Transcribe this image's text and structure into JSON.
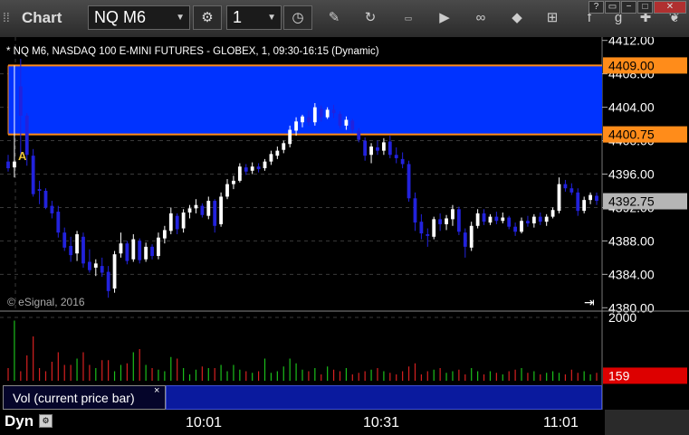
{
  "toolbar": {
    "app_title": "Chart",
    "symbol": "NQ M6",
    "interval": "1"
  },
  "window_buttons": [
    "?",
    "▭",
    "−",
    "□",
    "✕"
  ],
  "chart": {
    "header": "* NQ M6, NASDAQ 100 E-MINI FUTURES - GLOBEX, 1, 09:30-16:15 (Dynamic)",
    "watermark": "© eSignal, 2016",
    "marker": "A",
    "price_axis": {
      "ticks": [
        {
          "label": "4412.00",
          "value": 4412
        },
        {
          "label": "4408.00",
          "value": 4408
        },
        {
          "label": "4404.00",
          "value": 4404
        },
        {
          "label": "4400.00",
          "value": 4400
        },
        {
          "label": "4396.00",
          "value": 4396
        },
        {
          "label": "4392.00",
          "value": 4392
        },
        {
          "label": "4388.00",
          "value": 4388
        },
        {
          "label": "4384.00",
          "value": 4384
        },
        {
          "label": "4380.00",
          "value": 4380
        }
      ],
      "min": 4379.6,
      "max": 4412.4
    },
    "zone": {
      "top": 4409.0,
      "bottom": 4400.75,
      "top_label": "4409.00",
      "bottom_label": "4400.75"
    },
    "last_price": {
      "value": 4392.75,
      "label": "4392.75"
    },
    "candles": [
      {
        "o": 4397.5,
        "h": 4398.3,
        "l": 4396.3,
        "c": 4396.7
      },
      {
        "o": 4396.8,
        "h": 4409.0,
        "l": 4395.6,
        "c": 4397.5
      },
      {
        "o": 4406.5,
        "h": 4409.8,
        "l": 4398.0,
        "c": 4403.0
      },
      {
        "o": 4403.0,
        "h": 4403.3,
        "l": 4397.0,
        "c": 4398.3
      },
      {
        "o": 4398.2,
        "h": 4399.0,
        "l": 4393.3,
        "c": 4393.6
      },
      {
        "o": 4394.2,
        "h": 4395.2,
        "l": 4392.4,
        "c": 4394.0
      },
      {
        "o": 4394.0,
        "h": 4394.3,
        "l": 4391.8,
        "c": 4392.0
      },
      {
        "o": 4392.2,
        "h": 4392.8,
        "l": 4390.7,
        "c": 4391.3
      },
      {
        "o": 4391.5,
        "h": 4392.2,
        "l": 4388.4,
        "c": 4389.0
      },
      {
        "o": 4389.0,
        "h": 4389.6,
        "l": 4386.8,
        "c": 4387.2
      },
      {
        "o": 4387.4,
        "h": 4388.5,
        "l": 4385.5,
        "c": 4386.3
      },
      {
        "o": 4386.5,
        "h": 4389.2,
        "l": 4385.6,
        "c": 4388.8
      },
      {
        "o": 4388.5,
        "h": 4389.0,
        "l": 4384.8,
        "c": 4385.3
      },
      {
        "o": 4385.5,
        "h": 4387.0,
        "l": 4384.2,
        "c": 4384.5
      },
      {
        "o": 4384.8,
        "h": 4385.8,
        "l": 4383.8,
        "c": 4385.3
      },
      {
        "o": 4385.0,
        "h": 4386.0,
        "l": 4383.7,
        "c": 4384.2
      },
      {
        "o": 4384.3,
        "h": 4385.0,
        "l": 4381.2,
        "c": 4382.0
      },
      {
        "o": 4382.3,
        "h": 4386.8,
        "l": 4381.8,
        "c": 4386.4
      },
      {
        "o": 4386.5,
        "h": 4389.0,
        "l": 4386.0,
        "c": 4387.7
      },
      {
        "o": 4387.7,
        "h": 4388.0,
        "l": 4385.2,
        "c": 4385.6
      },
      {
        "o": 4385.8,
        "h": 4388.8,
        "l": 4385.5,
        "c": 4388.2
      },
      {
        "o": 4388.0,
        "h": 4388.3,
        "l": 4385.3,
        "c": 4385.7
      },
      {
        "o": 4385.8,
        "h": 4387.8,
        "l": 4385.5,
        "c": 4387.3
      },
      {
        "o": 4387.3,
        "h": 4387.6,
        "l": 4385.8,
        "c": 4386.2
      },
      {
        "o": 4386.2,
        "h": 4389.0,
        "l": 4385.8,
        "c": 4388.4
      },
      {
        "o": 4388.3,
        "h": 4389.8,
        "l": 4387.7,
        "c": 4389.3
      },
      {
        "o": 4389.2,
        "h": 4392.0,
        "l": 4388.8,
        "c": 4391.3
      },
      {
        "o": 4391.0,
        "h": 4391.3,
        "l": 4388.8,
        "c": 4389.4
      },
      {
        "o": 4389.5,
        "h": 4391.8,
        "l": 4389.0,
        "c": 4391.4
      },
      {
        "o": 4391.4,
        "h": 4392.3,
        "l": 4390.7,
        "c": 4391.9
      },
      {
        "o": 4391.9,
        "h": 4393.0,
        "l": 4391.3,
        "c": 4392.3
      },
      {
        "o": 4392.2,
        "h": 4392.5,
        "l": 4390.8,
        "c": 4391.1
      },
      {
        "o": 4391.0,
        "h": 4393.3,
        "l": 4390.6,
        "c": 4392.8
      },
      {
        "o": 4392.8,
        "h": 4393.0,
        "l": 4389.0,
        "c": 4389.8
      },
      {
        "o": 4390.0,
        "h": 4393.8,
        "l": 4389.7,
        "c": 4393.3
      },
      {
        "o": 4393.3,
        "h": 4395.4,
        "l": 4393.0,
        "c": 4394.8
      },
      {
        "o": 4394.8,
        "h": 4395.8,
        "l": 4394.2,
        "c": 4395.2
      },
      {
        "o": 4395.2,
        "h": 4397.3,
        "l": 4395.0,
        "c": 4396.9
      },
      {
        "o": 4396.8,
        "h": 4397.2,
        "l": 4395.9,
        "c": 4396.3
      },
      {
        "o": 4396.4,
        "h": 4397.4,
        "l": 4396.0,
        "c": 4396.9
      },
      {
        "o": 4396.9,
        "h": 4397.3,
        "l": 4396.2,
        "c": 4396.6
      },
      {
        "o": 4396.7,
        "h": 4397.8,
        "l": 4396.4,
        "c": 4397.5
      },
      {
        "o": 4397.5,
        "h": 4398.8,
        "l": 4397.1,
        "c": 4398.4
      },
      {
        "o": 4398.2,
        "h": 4399.3,
        "l": 4397.8,
        "c": 4398.8
      },
      {
        "o": 4398.9,
        "h": 4400.0,
        "l": 4398.5,
        "c": 4399.7
      },
      {
        "o": 4399.6,
        "h": 4401.8,
        "l": 4399.2,
        "c": 4401.3
      },
      {
        "o": 4401.2,
        "h": 4402.8,
        "l": 4400.6,
        "c": 4402.3
      },
      {
        "o": 4402.2,
        "h": 4403.1,
        "l": 4401.6,
        "c": 4402.9
      },
      {
        "o": 4402.8,
        "h": 4403.6,
        "l": 4401.8,
        "c": 4402.2
      },
      {
        "o": 4402.2,
        "h": 4404.5,
        "l": 4401.8,
        "c": 4404.0
      },
      {
        "o": 4403.8,
        "h": 4404.2,
        "l": 4402.3,
        "c": 4402.8
      },
      {
        "o": 4402.8,
        "h": 4404.0,
        "l": 4402.6,
        "c": 4403.7
      },
      {
        "o": 4403.7,
        "h": 4404.3,
        "l": 4402.7,
        "c": 4403.3
      },
      {
        "o": 4403.2,
        "h": 4403.5,
        "l": 4401.5,
        "c": 4401.8
      },
      {
        "o": 4401.8,
        "h": 4402.9,
        "l": 4401.3,
        "c": 4402.5
      },
      {
        "o": 4402.4,
        "h": 4402.6,
        "l": 4400.9,
        "c": 4401.3
      },
      {
        "o": 4401.2,
        "h": 4401.5,
        "l": 4399.8,
        "c": 4400.1
      },
      {
        "o": 4400.0,
        "h": 4400.4,
        "l": 4397.6,
        "c": 4398.2
      },
      {
        "o": 4398.3,
        "h": 4399.7,
        "l": 4397.3,
        "c": 4399.3
      },
      {
        "o": 4399.2,
        "h": 4400.0,
        "l": 4398.3,
        "c": 4398.8
      },
      {
        "o": 4398.8,
        "h": 4400.3,
        "l": 4398.3,
        "c": 4399.8
      },
      {
        "o": 4399.9,
        "h": 4400.6,
        "l": 4397.9,
        "c": 4398.3
      },
      {
        "o": 4398.3,
        "h": 4399.2,
        "l": 4397.3,
        "c": 4397.9
      },
      {
        "o": 4397.8,
        "h": 4398.6,
        "l": 4396.7,
        "c": 4397.2
      },
      {
        "o": 4397.2,
        "h": 4397.6,
        "l": 4392.7,
        "c": 4393.1
      },
      {
        "o": 4393.1,
        "h": 4393.8,
        "l": 4389.2,
        "c": 4390.2
      },
      {
        "o": 4390.3,
        "h": 4391.2,
        "l": 4388.2,
        "c": 4388.9
      },
      {
        "o": 4388.8,
        "h": 4389.5,
        "l": 4387.3,
        "c": 4388.6
      },
      {
        "o": 4388.5,
        "h": 4390.9,
        "l": 4388.2,
        "c": 4390.6
      },
      {
        "o": 4390.6,
        "h": 4391.3,
        "l": 4389.2,
        "c": 4390.0
      },
      {
        "o": 4390.0,
        "h": 4391.1,
        "l": 4389.3,
        "c": 4390.7
      },
      {
        "o": 4390.6,
        "h": 4392.3,
        "l": 4389.8,
        "c": 4391.8
      },
      {
        "o": 4391.8,
        "h": 4392.1,
        "l": 4388.7,
        "c": 4389.1
      },
      {
        "o": 4389.0,
        "h": 4389.5,
        "l": 4386.0,
        "c": 4387.3
      },
      {
        "o": 4387.2,
        "h": 4390.3,
        "l": 4386.8,
        "c": 4389.8
      },
      {
        "o": 4389.8,
        "h": 4391.8,
        "l": 4389.5,
        "c": 4391.3
      },
      {
        "o": 4391.3,
        "h": 4391.8,
        "l": 4389.9,
        "c": 4390.3
      },
      {
        "o": 4390.2,
        "h": 4391.2,
        "l": 4389.9,
        "c": 4390.9
      },
      {
        "o": 4390.9,
        "h": 4391.5,
        "l": 4390.0,
        "c": 4390.4
      },
      {
        "o": 4390.4,
        "h": 4391.4,
        "l": 4390.1,
        "c": 4390.8
      },
      {
        "o": 4390.8,
        "h": 4391.0,
        "l": 4389.4,
        "c": 4389.7
      },
      {
        "o": 4389.7,
        "h": 4390.2,
        "l": 4388.6,
        "c": 4389.1
      },
      {
        "o": 4389.1,
        "h": 4390.8,
        "l": 4388.9,
        "c": 4390.4
      },
      {
        "o": 4390.4,
        "h": 4391.0,
        "l": 4389.7,
        "c": 4390.1
      },
      {
        "o": 4390.1,
        "h": 4391.2,
        "l": 4389.6,
        "c": 4390.9
      },
      {
        "o": 4390.9,
        "h": 4391.4,
        "l": 4389.9,
        "c": 4390.3
      },
      {
        "o": 4390.3,
        "h": 4391.2,
        "l": 4389.8,
        "c": 4390.9
      },
      {
        "o": 4390.9,
        "h": 4392.0,
        "l": 4390.7,
        "c": 4391.7
      },
      {
        "o": 4391.6,
        "h": 4395.6,
        "l": 4391.3,
        "c": 4394.8
      },
      {
        "o": 4394.8,
        "h": 4395.3,
        "l": 4393.9,
        "c": 4394.3
      },
      {
        "o": 4394.3,
        "h": 4394.9,
        "l": 4393.5,
        "c": 4393.8
      },
      {
        "o": 4393.8,
        "h": 4394.3,
        "l": 4391.0,
        "c": 4391.6
      },
      {
        "o": 4391.6,
        "h": 4393.3,
        "l": 4391.3,
        "c": 4392.9
      },
      {
        "o": 4392.9,
        "h": 4393.8,
        "l": 4392.4,
        "c": 4393.5
      },
      {
        "o": 4393.4,
        "h": 4393.8,
        "l": 4392.3,
        "c": 4392.8
      }
    ],
    "volume": {
      "axis_label": "2000",
      "axis_max": 2000,
      "last_label": "159",
      "last_value": 159,
      "label": "Vol (current price bar)",
      "close_symbol": "×",
      "bars": [
        400,
        1900,
        300,
        800,
        1400,
        400,
        300,
        600,
        900,
        500,
        500,
        700,
        900,
        500,
        400,
        650,
        650,
        300,
        500,
        550,
        900,
        1000,
        500,
        400,
        350,
        300,
        750,
        700,
        400,
        200,
        350,
        450,
        400,
        400,
        500,
        300,
        500,
        350,
        300,
        250,
        300,
        700,
        250,
        300,
        450,
        700,
        550,
        350,
        300,
        400,
        200,
        450,
        350,
        300,
        400,
        200,
        250,
        300,
        350,
        400,
        300,
        250,
        200,
        300,
        450,
        550,
        200,
        300,
        350,
        400,
        250,
        300,
        350,
        200,
        400,
        300,
        200,
        300,
        250,
        200,
        300,
        350,
        400,
        250,
        300,
        200,
        250,
        300,
        250,
        200,
        350,
        250,
        300,
        200,
        250
      ]
    },
    "time_axis": {
      "panel_label": "Dyn",
      "labels": [
        "10:01",
        "10:31",
        "11:01"
      ]
    }
  },
  "colors": {
    "up_candle": "#ffffff",
    "down_candle": "#2222dd",
    "zone_fill": "#0033ff",
    "zone_line": "#ff8c1a",
    "up_volume": "#1bbf1b",
    "down_volume": "#d62020",
    "last_price_badge": "#b5b5b5",
    "volume_last_badge": "#dd0000"
  }
}
